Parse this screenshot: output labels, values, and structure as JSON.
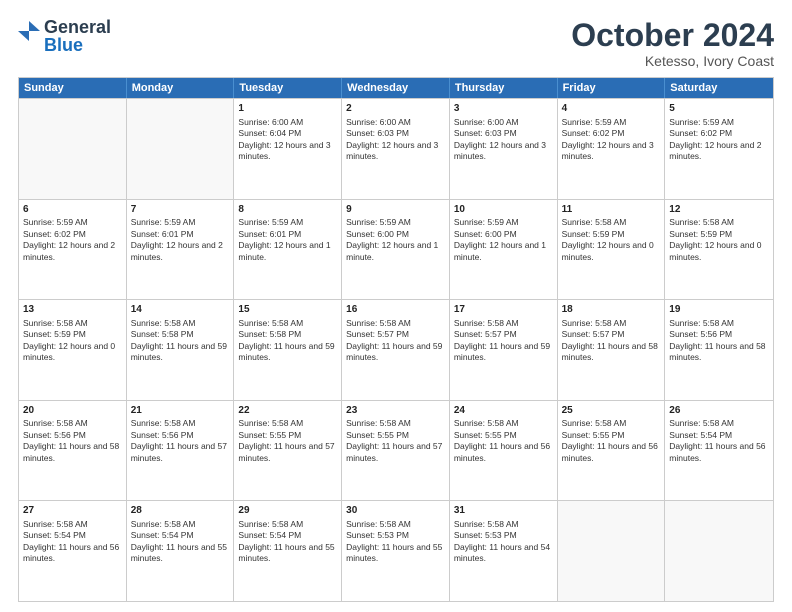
{
  "header": {
    "logo": {
      "line1": "General",
      "line2": "Blue"
    },
    "title": "October 2024",
    "location": "Ketesso, Ivory Coast"
  },
  "days_of_week": [
    "Sunday",
    "Monday",
    "Tuesday",
    "Wednesday",
    "Thursday",
    "Friday",
    "Saturday"
  ],
  "weeks": [
    [
      {
        "day": "",
        "empty": true
      },
      {
        "day": "",
        "empty": true
      },
      {
        "day": "1",
        "sunrise": "Sunrise: 6:00 AM",
        "sunset": "Sunset: 6:04 PM",
        "daylight": "Daylight: 12 hours and 3 minutes."
      },
      {
        "day": "2",
        "sunrise": "Sunrise: 6:00 AM",
        "sunset": "Sunset: 6:03 PM",
        "daylight": "Daylight: 12 hours and 3 minutes."
      },
      {
        "day": "3",
        "sunrise": "Sunrise: 6:00 AM",
        "sunset": "Sunset: 6:03 PM",
        "daylight": "Daylight: 12 hours and 3 minutes."
      },
      {
        "day": "4",
        "sunrise": "Sunrise: 5:59 AM",
        "sunset": "Sunset: 6:02 PM",
        "daylight": "Daylight: 12 hours and 3 minutes."
      },
      {
        "day": "5",
        "sunrise": "Sunrise: 5:59 AM",
        "sunset": "Sunset: 6:02 PM",
        "daylight": "Daylight: 12 hours and 2 minutes."
      }
    ],
    [
      {
        "day": "6",
        "sunrise": "Sunrise: 5:59 AM",
        "sunset": "Sunset: 6:02 PM",
        "daylight": "Daylight: 12 hours and 2 minutes."
      },
      {
        "day": "7",
        "sunrise": "Sunrise: 5:59 AM",
        "sunset": "Sunset: 6:01 PM",
        "daylight": "Daylight: 12 hours and 2 minutes."
      },
      {
        "day": "8",
        "sunrise": "Sunrise: 5:59 AM",
        "sunset": "Sunset: 6:01 PM",
        "daylight": "Daylight: 12 hours and 1 minute."
      },
      {
        "day": "9",
        "sunrise": "Sunrise: 5:59 AM",
        "sunset": "Sunset: 6:00 PM",
        "daylight": "Daylight: 12 hours and 1 minute."
      },
      {
        "day": "10",
        "sunrise": "Sunrise: 5:59 AM",
        "sunset": "Sunset: 6:00 PM",
        "daylight": "Daylight: 12 hours and 1 minute."
      },
      {
        "day": "11",
        "sunrise": "Sunrise: 5:58 AM",
        "sunset": "Sunset: 5:59 PM",
        "daylight": "Daylight: 12 hours and 0 minutes."
      },
      {
        "day": "12",
        "sunrise": "Sunrise: 5:58 AM",
        "sunset": "Sunset: 5:59 PM",
        "daylight": "Daylight: 12 hours and 0 minutes."
      }
    ],
    [
      {
        "day": "13",
        "sunrise": "Sunrise: 5:58 AM",
        "sunset": "Sunset: 5:59 PM",
        "daylight": "Daylight: 12 hours and 0 minutes."
      },
      {
        "day": "14",
        "sunrise": "Sunrise: 5:58 AM",
        "sunset": "Sunset: 5:58 PM",
        "daylight": "Daylight: 11 hours and 59 minutes."
      },
      {
        "day": "15",
        "sunrise": "Sunrise: 5:58 AM",
        "sunset": "Sunset: 5:58 PM",
        "daylight": "Daylight: 11 hours and 59 minutes."
      },
      {
        "day": "16",
        "sunrise": "Sunrise: 5:58 AM",
        "sunset": "Sunset: 5:57 PM",
        "daylight": "Daylight: 11 hours and 59 minutes."
      },
      {
        "day": "17",
        "sunrise": "Sunrise: 5:58 AM",
        "sunset": "Sunset: 5:57 PM",
        "daylight": "Daylight: 11 hours and 59 minutes."
      },
      {
        "day": "18",
        "sunrise": "Sunrise: 5:58 AM",
        "sunset": "Sunset: 5:57 PM",
        "daylight": "Daylight: 11 hours and 58 minutes."
      },
      {
        "day": "19",
        "sunrise": "Sunrise: 5:58 AM",
        "sunset": "Sunset: 5:56 PM",
        "daylight": "Daylight: 11 hours and 58 minutes."
      }
    ],
    [
      {
        "day": "20",
        "sunrise": "Sunrise: 5:58 AM",
        "sunset": "Sunset: 5:56 PM",
        "daylight": "Daylight: 11 hours and 58 minutes."
      },
      {
        "day": "21",
        "sunrise": "Sunrise: 5:58 AM",
        "sunset": "Sunset: 5:56 PM",
        "daylight": "Daylight: 11 hours and 57 minutes."
      },
      {
        "day": "22",
        "sunrise": "Sunrise: 5:58 AM",
        "sunset": "Sunset: 5:55 PM",
        "daylight": "Daylight: 11 hours and 57 minutes."
      },
      {
        "day": "23",
        "sunrise": "Sunrise: 5:58 AM",
        "sunset": "Sunset: 5:55 PM",
        "daylight": "Daylight: 11 hours and 57 minutes."
      },
      {
        "day": "24",
        "sunrise": "Sunrise: 5:58 AM",
        "sunset": "Sunset: 5:55 PM",
        "daylight": "Daylight: 11 hours and 56 minutes."
      },
      {
        "day": "25",
        "sunrise": "Sunrise: 5:58 AM",
        "sunset": "Sunset: 5:55 PM",
        "daylight": "Daylight: 11 hours and 56 minutes."
      },
      {
        "day": "26",
        "sunrise": "Sunrise: 5:58 AM",
        "sunset": "Sunset: 5:54 PM",
        "daylight": "Daylight: 11 hours and 56 minutes."
      }
    ],
    [
      {
        "day": "27",
        "sunrise": "Sunrise: 5:58 AM",
        "sunset": "Sunset: 5:54 PM",
        "daylight": "Daylight: 11 hours and 56 minutes."
      },
      {
        "day": "28",
        "sunrise": "Sunrise: 5:58 AM",
        "sunset": "Sunset: 5:54 PM",
        "daylight": "Daylight: 11 hours and 55 minutes."
      },
      {
        "day": "29",
        "sunrise": "Sunrise: 5:58 AM",
        "sunset": "Sunset: 5:54 PM",
        "daylight": "Daylight: 11 hours and 55 minutes."
      },
      {
        "day": "30",
        "sunrise": "Sunrise: 5:58 AM",
        "sunset": "Sunset: 5:53 PM",
        "daylight": "Daylight: 11 hours and 55 minutes."
      },
      {
        "day": "31",
        "sunrise": "Sunrise: 5:58 AM",
        "sunset": "Sunset: 5:53 PM",
        "daylight": "Daylight: 11 hours and 54 minutes."
      },
      {
        "day": "",
        "empty": true
      },
      {
        "day": "",
        "empty": true
      }
    ]
  ]
}
